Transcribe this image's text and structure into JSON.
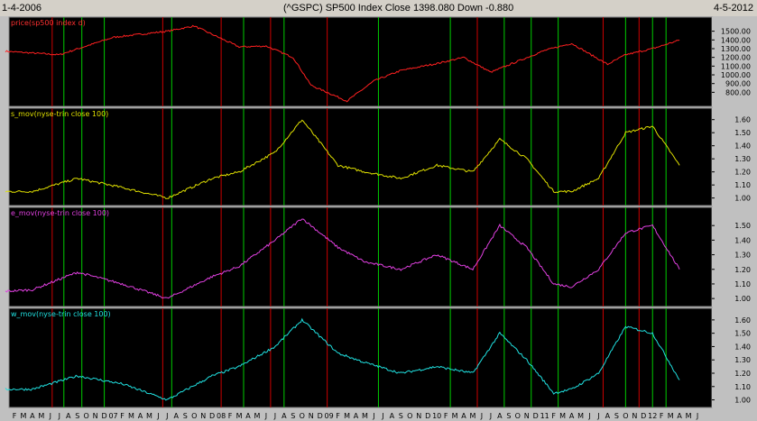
{
  "header": {
    "start_date": "1-4-2006",
    "title": "(^GSPC) SP500 Index   Close 1398.080   Down -0.880",
    "end_date": "4-5-2012"
  },
  "colors": {
    "bg": "#000000",
    "frame": "#c0c0c0",
    "grid": "#555555",
    "price": "#ff2020",
    "s_mov": "#e0e000",
    "e_mov": "#e040e0",
    "w_mov": "#20e0e0",
    "buy": "#00cc00",
    "sell": "#cc0000",
    "panel_label": "#ff3030"
  },
  "chart_data": [
    {
      "type": "line",
      "title": "price(sp500 index d)",
      "series": [
        {
          "name": "price(sp500 index d)",
          "x": [
            "2006-01",
            "2006-07",
            "2007-01",
            "2007-07",
            "2007-10",
            "2008-03",
            "2008-06",
            "2008-09",
            "2008-11",
            "2009-03",
            "2009-06",
            "2009-09",
            "2010-01",
            "2010-04",
            "2010-07",
            "2011-01",
            "2011-04",
            "2011-08",
            "2011-10",
            "2012-01",
            "2012-04"
          ],
          "values": [
            1270,
            1230,
            1430,
            1500,
            1560,
            1320,
            1330,
            1200,
            880,
            700,
            930,
            1050,
            1130,
            1200,
            1030,
            1280,
            1360,
            1120,
            1230,
            1300,
            1398
          ]
        }
      ],
      "yticks": [
        "1500.00",
        "1400.00",
        "1300.00",
        "1200.00",
        "1100.00",
        "1000.00",
        "900.00",
        "800.00"
      ],
      "ylim": [
        680,
        1620
      ]
    },
    {
      "type": "line",
      "title": "s_mov(nyse-trin close 100)",
      "series": [
        {
          "name": "s_mov(nyse-trin close 100)",
          "x": [
            "2006-01",
            "2006-04",
            "2006-09",
            "2007-02",
            "2007-07",
            "2007-12",
            "2008-03",
            "2008-07",
            "2008-10",
            "2009-02",
            "2009-05",
            "2009-09",
            "2010-01",
            "2010-05",
            "2010-08",
            "2010-11",
            "2011-02",
            "2011-04",
            "2011-07",
            "2011-10",
            "2012-01",
            "2012-04"
          ],
          "values": [
            1.05,
            1.05,
            1.15,
            1.08,
            1.0,
            1.15,
            1.2,
            1.35,
            1.6,
            1.25,
            1.2,
            1.15,
            1.25,
            1.2,
            1.45,
            1.3,
            1.05,
            1.05,
            1.15,
            1.5,
            1.55,
            1.25
          ]
        }
      ],
      "yticks": [
        "1.60",
        "1.50",
        "1.40",
        "1.30",
        "1.20",
        "1.10",
        "1.00"
      ],
      "ylim": [
        0.97,
        1.66
      ]
    },
    {
      "type": "line",
      "title": "e_mov(nyse-trin close 100)",
      "series": [
        {
          "name": "e_mov(nyse-trin close 100)",
          "x": [
            "2006-01",
            "2006-04",
            "2006-09",
            "2007-02",
            "2007-07",
            "2007-12",
            "2008-03",
            "2008-07",
            "2008-10",
            "2009-02",
            "2009-05",
            "2009-09",
            "2010-01",
            "2010-05",
            "2010-08",
            "2010-11",
            "2011-02",
            "2011-04",
            "2011-07",
            "2011-10",
            "2012-01",
            "2012-04"
          ],
          "values": [
            1.05,
            1.06,
            1.18,
            1.1,
            1.0,
            1.15,
            1.22,
            1.4,
            1.55,
            1.35,
            1.25,
            1.2,
            1.3,
            1.2,
            1.5,
            1.35,
            1.1,
            1.08,
            1.2,
            1.45,
            1.5,
            1.2
          ]
        }
      ],
      "yticks": [
        "1.50",
        "1.40",
        "1.30",
        "1.20",
        "1.10",
        "1.00"
      ],
      "ylim": [
        0.97,
        1.6
      ]
    },
    {
      "type": "line",
      "title": "w_mov(nyse-trin close 100)",
      "series": [
        {
          "name": "w_mov(nyse-trin close 100)",
          "x": [
            "2006-01",
            "2006-04",
            "2006-09",
            "2007-02",
            "2007-07",
            "2007-12",
            "2008-03",
            "2008-07",
            "2008-10",
            "2009-02",
            "2009-05",
            "2009-09",
            "2010-01",
            "2010-05",
            "2010-08",
            "2010-11",
            "2011-02",
            "2011-04",
            "2011-07",
            "2011-10",
            "2012-01",
            "2012-04"
          ],
          "values": [
            1.08,
            1.08,
            1.18,
            1.12,
            1.0,
            1.18,
            1.25,
            1.4,
            1.6,
            1.35,
            1.28,
            1.2,
            1.25,
            1.2,
            1.5,
            1.3,
            1.05,
            1.08,
            1.2,
            1.55,
            1.5,
            1.15
          ]
        }
      ],
      "yticks": [
        "1.60",
        "1.50",
        "1.40",
        "1.30",
        "1.20",
        "1.10",
        "1.00"
      ],
      "ylim": [
        0.97,
        1.66
      ]
    }
  ],
  "x_axis": {
    "month_labels": [
      "F",
      "M",
      "A",
      "M",
      "J",
      "J",
      "A",
      "S",
      "O",
      "N",
      "D",
      "07",
      "F",
      "M",
      "A",
      "M",
      "J",
      "J",
      "A",
      "S",
      "O",
      "N",
      "D",
      "08",
      "F",
      "M",
      "A",
      "M",
      "J",
      "J",
      "A",
      "S",
      "O",
      "N",
      "D",
      "09",
      "F",
      "M",
      "A",
      "M",
      "J",
      "J",
      "A",
      "S",
      "O",
      "N",
      "D",
      "10",
      "F",
      "M",
      "A",
      "M",
      "J",
      "J",
      "A",
      "S",
      "O",
      "N",
      "D",
      "11",
      "F",
      "M",
      "A",
      "M",
      "J",
      "J",
      "A",
      "S",
      "O",
      "N",
      "D",
      "12",
      "F",
      "M",
      "A",
      "M",
      "J"
    ]
  },
  "signals": {
    "buy_months": [
      5.5,
      7.5,
      10,
      17.5,
      25.5,
      30,
      40.5,
      48.5,
      54.5,
      57.5,
      60.5,
      68,
      71,
      72.5
    ],
    "sell_months": [
      4.2,
      16.5,
      23,
      28.5,
      34.8,
      51.5,
      65.5,
      69.5
    ]
  }
}
